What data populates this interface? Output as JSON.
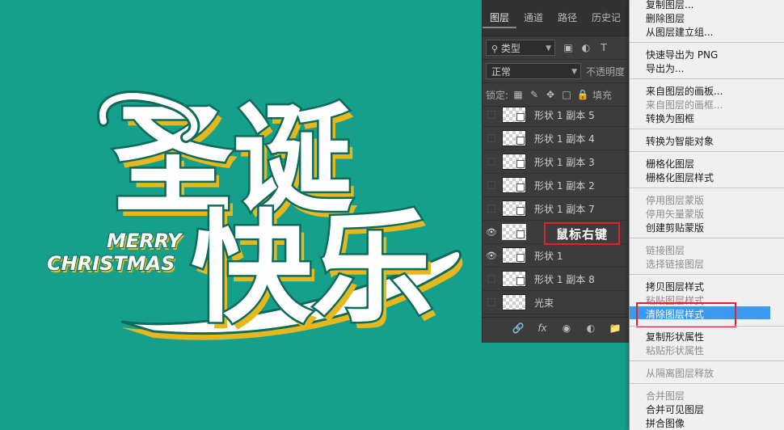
{
  "artwork": {
    "title_cn_top": "圣诞",
    "title_cn_bottom": "快乐",
    "merry": "MERRY",
    "christmas": "CHRISTMAS",
    "colors": {
      "background": "#14a08b",
      "fill": "#ffffff",
      "outline": "#0d6b5c",
      "shadow": "#e6b81e"
    }
  },
  "layers_panel": {
    "tabs": [
      "图层",
      "通道",
      "路径",
      "历史记"
    ],
    "active_tab": "图层",
    "filter_label": "类型",
    "blend_mode": "正常",
    "opacity_label": "不透明度",
    "lock_label": "锁定:",
    "fill_label": "填充",
    "layers": [
      {
        "name": "形状 1 副本 5",
        "visible": false
      },
      {
        "name": "形状 1 副本 4",
        "visible": false
      },
      {
        "name": "形状 1 副本 3",
        "visible": false
      },
      {
        "name": "形状 1 副本 2",
        "visible": false
      },
      {
        "name": "形状 1 副本 7",
        "visible": false
      },
      {
        "name": "",
        "visible": true,
        "annotation": "鼠标右键"
      },
      {
        "name": "形状 1",
        "visible": true
      },
      {
        "name": "形状 1 副本 8",
        "visible": false
      },
      {
        "name": "光束",
        "visible": false
      }
    ],
    "footer_icons": [
      "link-icon",
      "fx-icon",
      "mask-icon",
      "adjustment-icon",
      "folder-icon"
    ]
  },
  "context_menu": {
    "items": [
      {
        "label": "复制图层...",
        "disabled": false
      },
      {
        "label": "删除图层",
        "disabled": false
      },
      {
        "label": "从图层建立组...",
        "disabled": false
      },
      {
        "label": "快速导出为 PNG",
        "disabled": false
      },
      {
        "label": "导出为...",
        "disabled": false
      },
      {
        "label": "来自图层的画板...",
        "disabled": false
      },
      {
        "label": "来自图层的画框...",
        "disabled": true
      },
      {
        "label": "转换为图框",
        "disabled": false
      },
      {
        "label": "转换为智能对象",
        "disabled": false
      },
      {
        "label": "栅格化图层",
        "disabled": false
      },
      {
        "label": "栅格化图层样式",
        "disabled": false
      },
      {
        "label": "停用图层蒙版",
        "disabled": true
      },
      {
        "label": "停用矢量蒙版",
        "disabled": true
      },
      {
        "label": "创建剪贴蒙版",
        "disabled": false
      },
      {
        "label": "链接图层",
        "disabled": true
      },
      {
        "label": "选择链接图层",
        "disabled": true
      },
      {
        "label": "拷贝图层样式",
        "disabled": false
      },
      {
        "label": "粘贴图层样式",
        "disabled": true
      },
      {
        "label": "清除图层样式",
        "disabled": false,
        "selected": true
      },
      {
        "label": "复制形状属性",
        "disabled": false
      },
      {
        "label": "粘贴形状属性",
        "disabled": true
      },
      {
        "label": "从隔离图层释放",
        "disabled": true
      },
      {
        "label": "合并图层",
        "disabled": true
      },
      {
        "label": "合并可见图层",
        "disabled": false
      },
      {
        "label": "拼合图像",
        "disabled": false
      }
    ]
  }
}
